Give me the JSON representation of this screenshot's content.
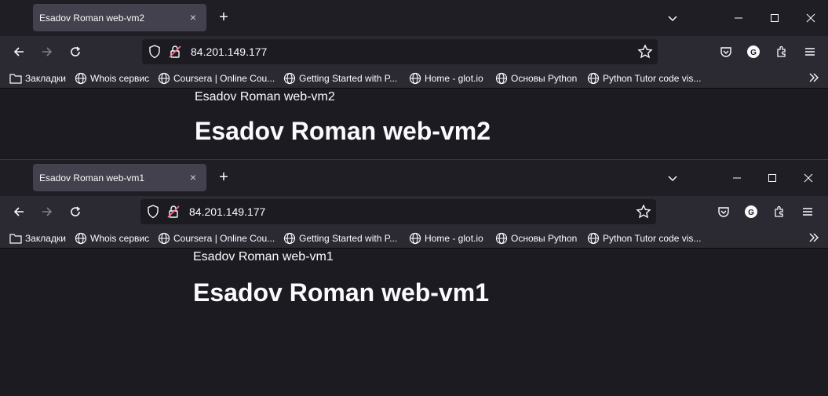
{
  "windows": [
    {
      "tab_title": "Esadov Roman web-vm2",
      "url": "84.201.149.177",
      "page_text": "Esadov Roman web-vm2",
      "page_heading": "Esadov Roman web-vm2"
    },
    {
      "tab_title": "Esadov Roman web-vm1",
      "url": "84.201.149.177",
      "page_text": "Esadov Roman web-vm1",
      "page_heading": "Esadov Roman web-vm1"
    }
  ],
  "bookmarks": [
    {
      "label": "Закладки",
      "icon": "folder-icon"
    },
    {
      "label": "Whois сервис",
      "icon": "globe-icon"
    },
    {
      "label": "Coursera | Online Cou...",
      "icon": "globe-icon"
    },
    {
      "label": "Getting Started with P...",
      "icon": "globe-icon"
    },
    {
      "label": "Home - glot.io",
      "icon": "globe-icon"
    },
    {
      "label": "Основы Python",
      "icon": "globe-icon"
    },
    {
      "label": "Python Tutor code vis...",
      "icon": "globe-icon"
    }
  ],
  "icons": {
    "tab_close": "×",
    "new_tab": "+"
  },
  "colors": {
    "page_bg": "#1c1b22",
    "toolbar_bg": "#2b2a33",
    "active_tab": "#42414d",
    "text": "#fbfbfe",
    "lock_red": "#ff6b8a"
  }
}
